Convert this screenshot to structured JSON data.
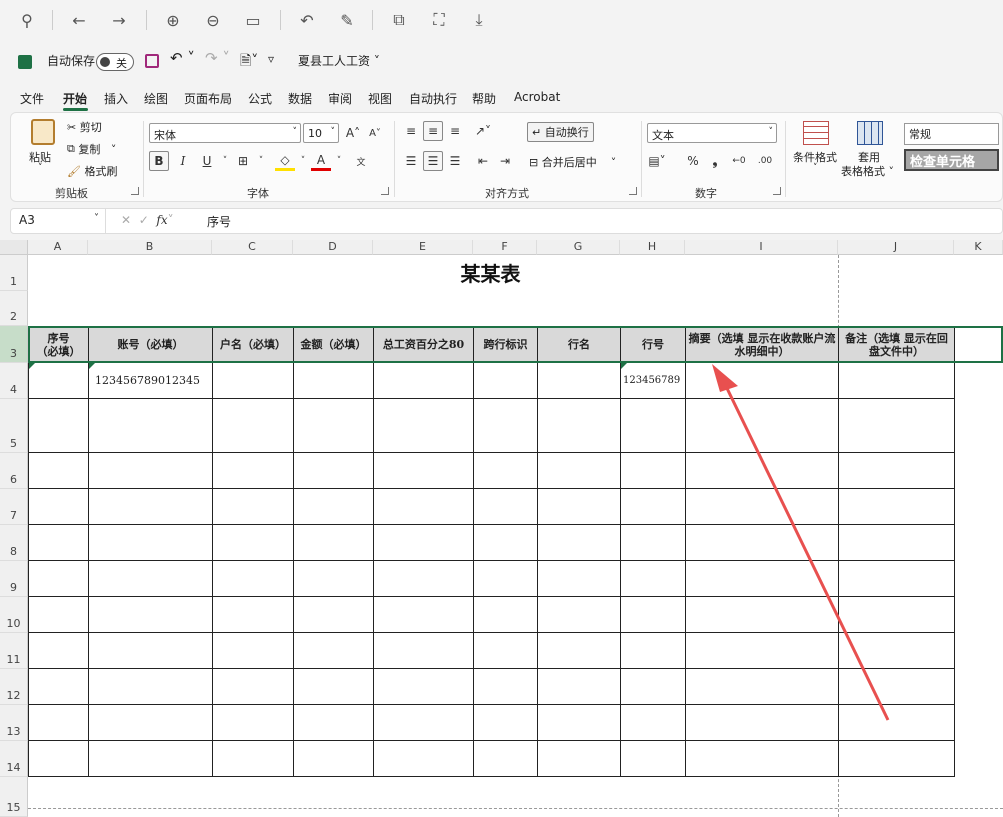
{
  "quick_access": {
    "autosave_label": "自动保存",
    "autosave_state": "关",
    "file_title": "夏县工人工资"
  },
  "menu_tabs": [
    "文件",
    "开始",
    "插入",
    "绘图",
    "页面布局",
    "公式",
    "数据",
    "审阅",
    "视图",
    "自动执行",
    "帮助",
    "Acrobat"
  ],
  "ribbon": {
    "clipboard": {
      "title": "剪贴板",
      "paste": "粘贴",
      "cut": "剪切",
      "copy": "复制",
      "format_painter": "格式刷"
    },
    "font": {
      "title": "字体",
      "font_name": "宋体",
      "font_size": "10",
      "bold": "B",
      "italic": "I",
      "underline": "U"
    },
    "alignment": {
      "title": "对齐方式",
      "wrap_text": "自动换行",
      "merge_center": "合并后居中"
    },
    "number": {
      "title": "数字",
      "format": "文本"
    },
    "styles": {
      "conditional_format": "条件格式",
      "table_format_1": "套用",
      "table_format_2": "表格格式",
      "style_normal": "常规",
      "style_check_cell": "检查单元格"
    }
  },
  "formula_bar": {
    "name_box": "A3",
    "content": "序号"
  },
  "columns": [
    "A",
    "B",
    "C",
    "D",
    "E",
    "F",
    "G",
    "H",
    "I",
    "J",
    "K"
  ],
  "rows": [
    "1",
    "2",
    "3",
    "4",
    "5",
    "6",
    "7",
    "8",
    "9",
    "10",
    "11",
    "12",
    "13",
    "14",
    "15"
  ],
  "sheet": {
    "title": "某某表",
    "headers": [
      "序号\n（必填）",
      "账号（必填）",
      "户名（必填）",
      "金额（必填）",
      "总工资百分之80",
      "跨行标识",
      "行名",
      "行号",
      "摘要（选填  显示在收款账户流水明细中）",
      "备注（选填  显示在回盘文件中）"
    ],
    "row4": {
      "account": "123456789012345",
      "bank_no": "123456789"
    }
  }
}
